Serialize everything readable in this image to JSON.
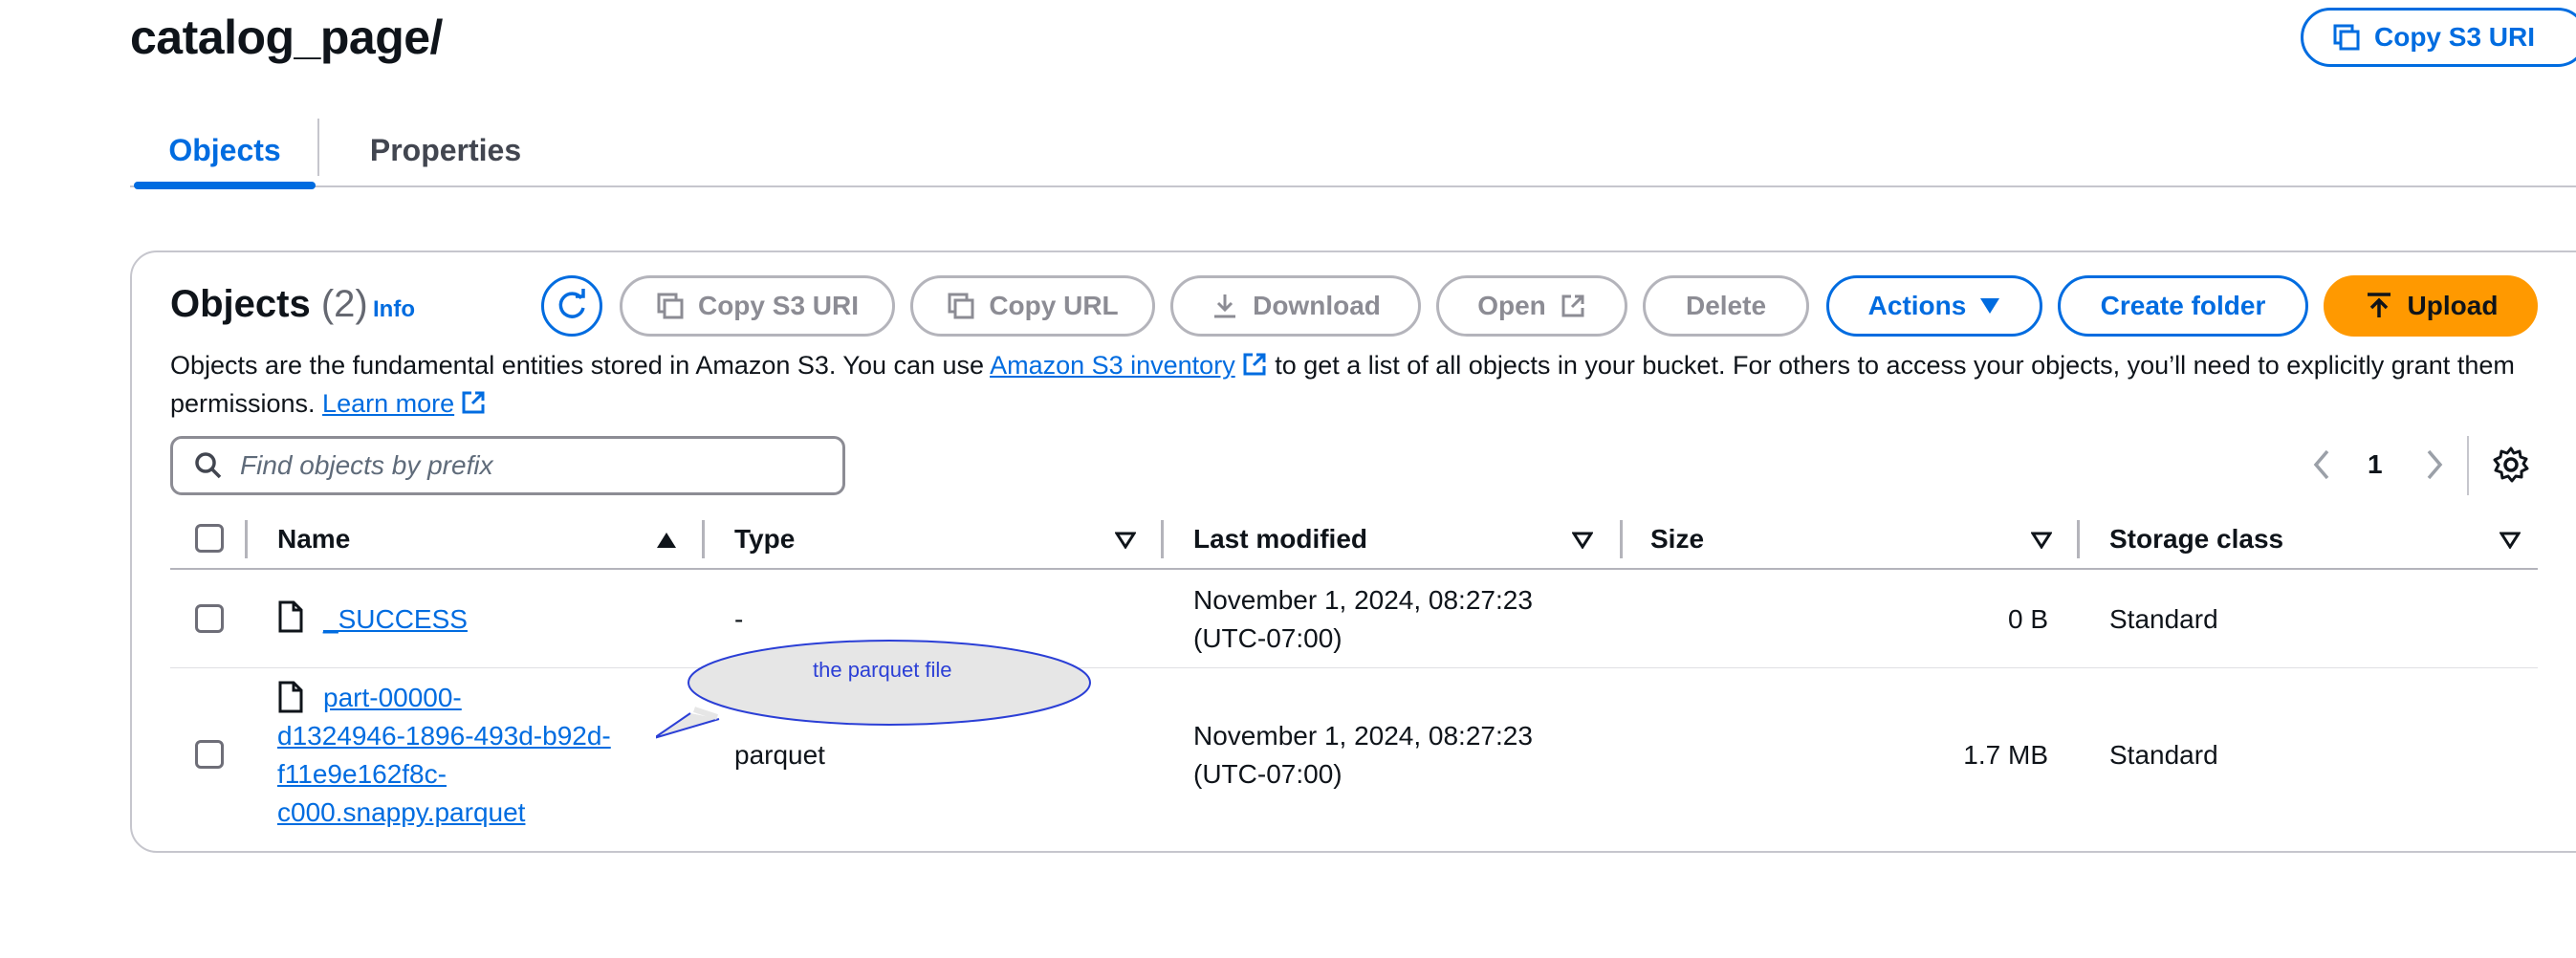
{
  "header": {
    "title": "catalog_page/",
    "copy_s3_uri": "Copy S3 URI"
  },
  "tabs": [
    {
      "label": "Objects",
      "active": true
    },
    {
      "label": "Properties",
      "active": false
    }
  ],
  "objects_panel": {
    "heading": "Objects",
    "count": "(2)",
    "info": "Info",
    "buttons": {
      "copy_s3_uri": "Copy S3 URI",
      "copy_url": "Copy URL",
      "download": "Download",
      "open": "Open",
      "delete": "Delete",
      "actions": "Actions",
      "create_folder": "Create folder",
      "upload": "Upload"
    },
    "description": {
      "part1": "Objects are the fundamental entities stored in Amazon S3. You can use ",
      "inventory_link": "Amazon S3 inventory",
      "part2": " to get a list of all objects in your bucket. For others to access your objects, you’ll need to explicitly grant them permissions. ",
      "learn_more": "Learn more"
    },
    "search": {
      "placeholder": "Find objects by prefix",
      "value": ""
    },
    "pagination": {
      "current_page": "1"
    }
  },
  "table": {
    "columns": [
      "Name",
      "Type",
      "Last modified",
      "Size",
      "Storage class"
    ],
    "rows": [
      {
        "name": "_SUCCESS",
        "type": "-",
        "last_modified_1": "November 1, 2024, 08:27:23",
        "last_modified_2": "(UTC-07:00)",
        "size": "0 B",
        "storage_class": "Standard"
      },
      {
        "name_lines": [
          "part-00000-",
          "d1324946-1896-493d-b92d-",
          "f11e9e162f8c-",
          "c000.snappy.parquet"
        ],
        "type": "parquet",
        "last_modified_1": "November 1, 2024, 08:27:23",
        "last_modified_2": "(UTC-07:00)",
        "size": "1.7 MB",
        "storage_class": "Standard"
      }
    ]
  },
  "annotation": {
    "callout_text": "the parquet file"
  },
  "colors": {
    "accent": "#006ce0",
    "upload": "#ff9900",
    "border": "#c6c6cd"
  }
}
